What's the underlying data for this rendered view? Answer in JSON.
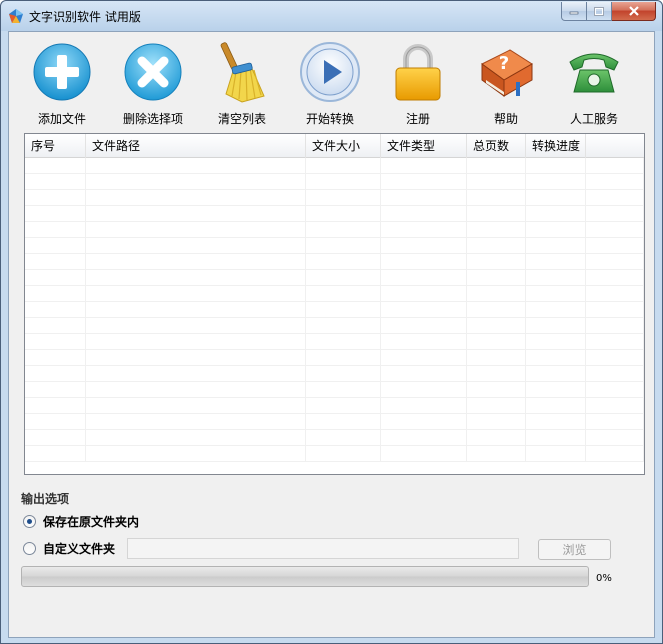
{
  "window": {
    "title": "文字识别软件 试用版"
  },
  "toolbar": {
    "items": [
      {
        "label": "添加文件",
        "icon": "add-icon"
      },
      {
        "label": "删除选择项",
        "icon": "delete-icon"
      },
      {
        "label": "清空列表",
        "icon": "broom-icon"
      },
      {
        "label": "开始转换",
        "icon": "play-icon"
      },
      {
        "label": "注册",
        "icon": "lock-icon"
      },
      {
        "label": "帮助",
        "icon": "help-book-icon"
      },
      {
        "label": "人工服务",
        "icon": "phone-icon"
      }
    ]
  },
  "file_list": {
    "columns": [
      "序号",
      "文件路径",
      "文件大小",
      "文件类型",
      "总页数",
      "转换进度"
    ],
    "rows": []
  },
  "output": {
    "title": "输出选项",
    "option_original": "保存在原文件夹内",
    "option_custom": "自定义文件夹",
    "folder_value": "",
    "browse_label": "浏览",
    "selected": "original"
  },
  "progress": {
    "percent": 0,
    "text": "0%"
  },
  "colors": {
    "add": "#29a3d8",
    "delete": "#3fb2e0",
    "play": "#3b6fb6",
    "lock": "#f2a900",
    "help": "#d9622b",
    "phone": "#3aa34a"
  }
}
